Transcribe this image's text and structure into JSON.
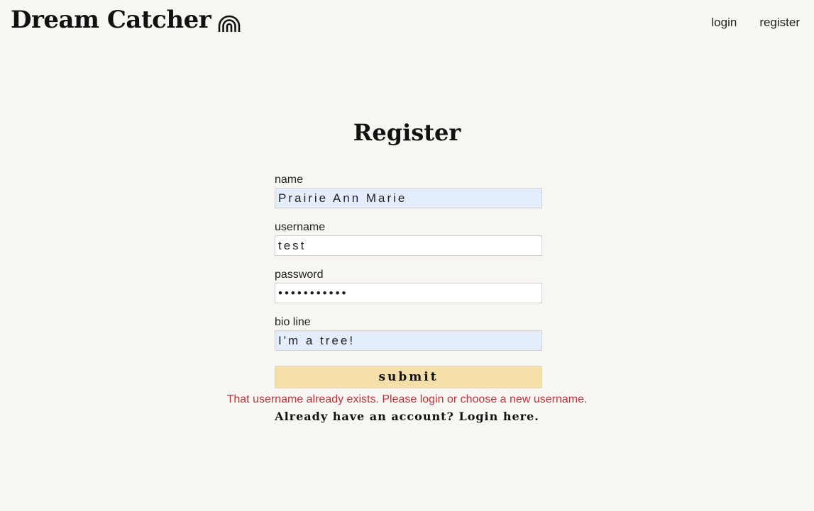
{
  "header": {
    "brand_title": "Dream Catcher",
    "brand_icon": "rainbow-icon",
    "nav": {
      "login_label": "login",
      "register_label": "register"
    }
  },
  "form": {
    "title": "Register",
    "fields": {
      "name": {
        "label": "name",
        "value": "Prairie Ann Marie"
      },
      "username": {
        "label": "username",
        "value": "test"
      },
      "password": {
        "label": "password",
        "value": "•••••••••••"
      },
      "bio": {
        "label": "bio line",
        "value": "I'm a tree!"
      }
    },
    "submit_label": "submit",
    "error_message": "That username already exists. Please login or choose a new username.",
    "login_prompt": "Already have an account? Login here."
  },
  "colors": {
    "background": "#f8f6f2",
    "submit_background": "#f4dfa9",
    "error_text": "#b8353c",
    "autofill_background": "#e3edfb"
  }
}
